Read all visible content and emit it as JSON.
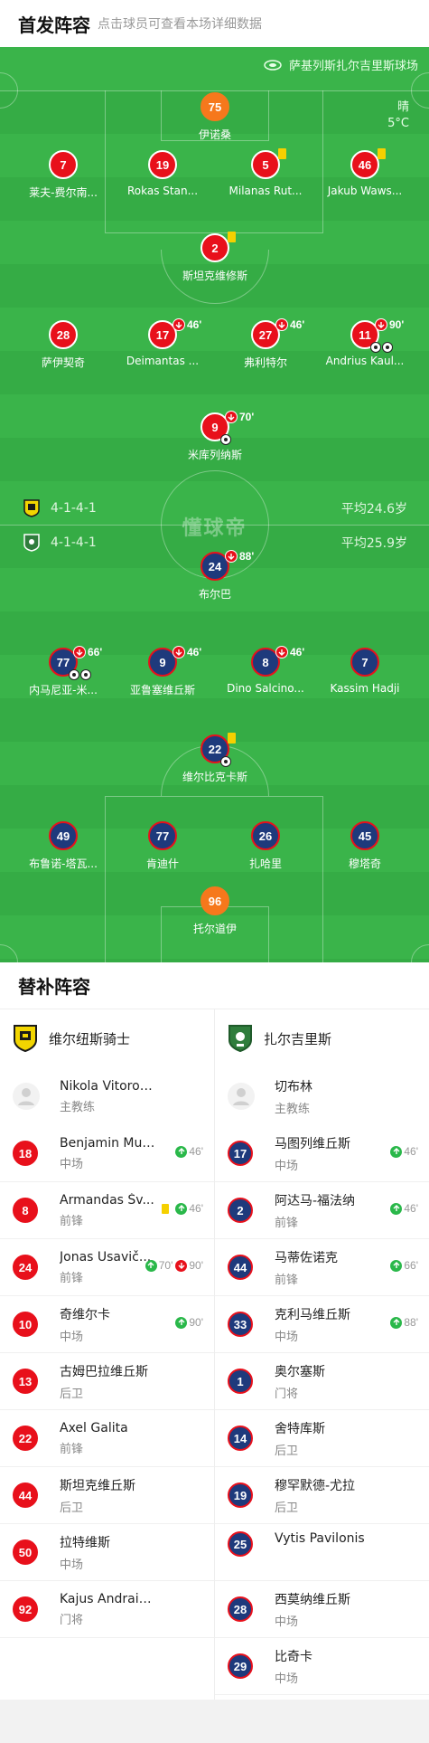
{
  "header": {
    "title": "首发阵容",
    "subtitle": "点击球员可查看本场详细数据"
  },
  "pitch": {
    "venue": "萨基列斯扎尔吉里斯球场",
    "weather": "晴",
    "temperature": "5°C",
    "watermark": "懂球帝",
    "home_form": {
      "formation": "4-1-4-1",
      "avg_age": "平均24.6岁"
    },
    "away_form": {
      "formation": "4-1-4-1",
      "avg_age": "平均25.9岁"
    },
    "home_players": [
      {
        "num": "75",
        "name": "伊诺桑",
        "kind": "orange"
      },
      {
        "num": "7",
        "name": "莱夫-费尔南..."
      },
      {
        "num": "19",
        "name": "Rokas Stan..."
      },
      {
        "num": "5",
        "name": "Milanas Rut...",
        "yellow": true
      },
      {
        "num": "46",
        "name": "Jakub Waws...",
        "yellow": true
      },
      {
        "num": "2",
        "name": "斯坦克维修斯",
        "yellow": true
      },
      {
        "num": "28",
        "name": "萨伊契奇"
      },
      {
        "num": "17",
        "name": "Deimantas ...",
        "sub": "46'"
      },
      {
        "num": "27",
        "name": "弗利特尔",
        "sub": "46'"
      },
      {
        "num": "11",
        "name": "Andrius Kaul...",
        "sub": "90'",
        "goals": 2
      },
      {
        "num": "9",
        "name": "米库列纳斯",
        "sub": "70'",
        "goals": 1
      }
    ],
    "away_players": [
      {
        "num": "24",
        "name": "布尔巴",
        "sub": "88'"
      },
      {
        "num": "77",
        "name": "内马尼亚-米...",
        "sub": "66'",
        "goals": 2
      },
      {
        "num": "9",
        "name": "亚鲁塞维丘斯",
        "sub": "46'"
      },
      {
        "num": "8",
        "name": "Dino Salcino...",
        "sub": "46'"
      },
      {
        "num": "7",
        "name": "Kassim Hadji"
      },
      {
        "num": "22",
        "name": "维尔比克卡斯",
        "yellow": true,
        "goals": 1
      },
      {
        "num": "49",
        "name": "布鲁诺-塔瓦..."
      },
      {
        "num": "77",
        "name": "肯迪什"
      },
      {
        "num": "26",
        "name": "扎哈里"
      },
      {
        "num": "45",
        "name": "穆塔奇"
      },
      {
        "num": "96",
        "name": "托尔道伊",
        "kind": "orange"
      }
    ]
  },
  "subs": {
    "title": "替补阵容",
    "home": {
      "team": "维尔纽斯骑士",
      "coach": {
        "name": "Nikola Vitorovic",
        "role": "主教练"
      },
      "players": [
        {
          "num": "18",
          "name": "Benjamin Mul...",
          "pos": "中场",
          "in": "46'"
        },
        {
          "num": "8",
          "name": "Armandas Šv...",
          "pos": "前锋",
          "in": "46'",
          "yellow": true
        },
        {
          "num": "24",
          "name": "Jonas Usavič...",
          "pos": "前锋",
          "in": "70'",
          "out": "90'"
        },
        {
          "num": "10",
          "name": "奇维尔卡",
          "pos": "中场",
          "in": "90'"
        },
        {
          "num": "13",
          "name": "古姆巴拉维丘斯",
          "pos": "后卫"
        },
        {
          "num": "22",
          "name": "Axel Galita",
          "pos": "前锋"
        },
        {
          "num": "44",
          "name": "斯坦克维丘斯",
          "pos": "后卫"
        },
        {
          "num": "50",
          "name": "拉特维斯",
          "pos": "中场"
        },
        {
          "num": "92",
          "name": "Kajus Andraik...",
          "pos": "门将"
        }
      ]
    },
    "away": {
      "team": "扎尔吉里斯",
      "coach": {
        "name": "切布林",
        "role": "主教练"
      },
      "players": [
        {
          "num": "17",
          "name": "马图列维丘斯",
          "pos": "中场",
          "in": "46'"
        },
        {
          "num": "2",
          "name": "阿达马-福法纳",
          "pos": "前锋",
          "in": "46'"
        },
        {
          "num": "44",
          "name": "马蒂佐诺克",
          "pos": "前锋",
          "in": "66'"
        },
        {
          "num": "33",
          "name": "克利马维丘斯",
          "pos": "中场",
          "in": "88'"
        },
        {
          "num": "1",
          "name": "奥尔塞斯",
          "pos": "门将"
        },
        {
          "num": "14",
          "name": "舍特库斯",
          "pos": "后卫"
        },
        {
          "num": "19",
          "name": "穆罕默德-尤拉",
          "pos": "后卫"
        },
        {
          "num": "25",
          "name": "Vytis Pavilonis",
          "pos": ""
        },
        {
          "num": "28",
          "name": "西莫纳维丘斯",
          "pos": "中场"
        },
        {
          "num": "29",
          "name": "比奇卡",
          "pos": "中场"
        }
      ]
    }
  },
  "colors": {
    "pitch": "#35ac45",
    "home": "#e8101b",
    "away": "#1e3a7c",
    "keeper": "#f6781c"
  }
}
